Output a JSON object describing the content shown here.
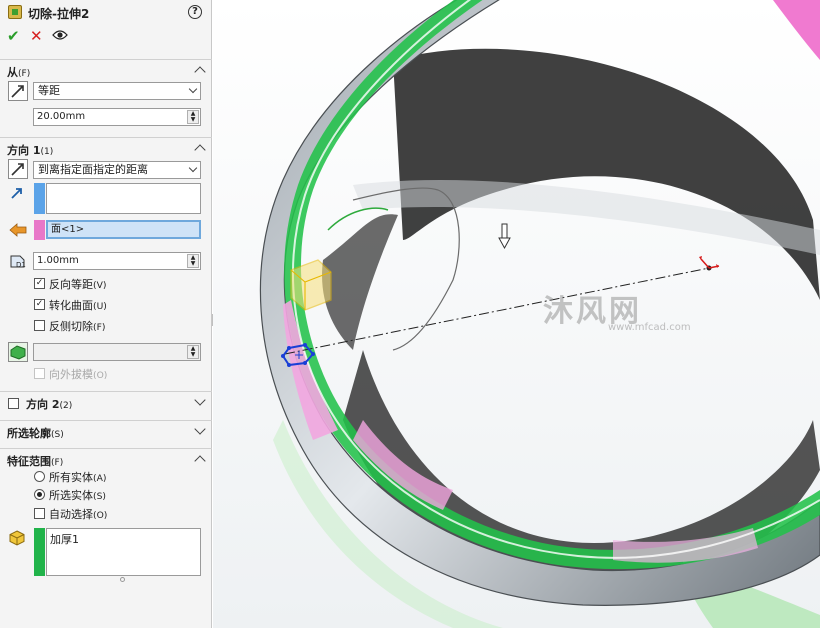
{
  "panel": {
    "title": "切除-拉伸2",
    "help_icon": "help-circle-icon",
    "actions": {
      "ok_icon": "check-icon",
      "cancel_icon": "close-icon",
      "preview_icon": "eye-icon"
    }
  },
  "from": {
    "header": "从",
    "header_key": "(F)",
    "start_condition": "等距",
    "offset_value": "20.00mm"
  },
  "direction1": {
    "header": "方向 1",
    "header_key": "(1)",
    "end_condition": "到离指定面指定的距离",
    "face_selection": "面<1>",
    "offset_distance": "1.00mm",
    "options": [
      {
        "label": "反向等距",
        "key": "(V)",
        "checked": true
      },
      {
        "label": "转化曲面",
        "key": "(U)",
        "checked": true
      },
      {
        "label": "反侧切除",
        "key": "(F)",
        "checked": false
      }
    ],
    "draft_value": "",
    "draft_outward": {
      "label": "向外拔模",
      "key": "(O)",
      "checked": false,
      "disabled": true
    }
  },
  "direction2": {
    "header": "方向 2",
    "header_key": "(2)",
    "checked": false
  },
  "selected_contours": {
    "header": "所选轮廓",
    "header_key": "(S)"
  },
  "feature_scope": {
    "header": "特征范围",
    "header_key": "(F)",
    "radios": [
      {
        "label": "所有实体",
        "key": "(A)",
        "selected": false
      },
      {
        "label": "所选实体",
        "key": "(S)",
        "selected": true
      }
    ],
    "auto_select": {
      "label": "自动选择",
      "key": "(O)",
      "checked": false
    },
    "bodies": [
      "加厚1"
    ]
  },
  "watermark": {
    "text": "沐风网",
    "sub": "www.mfcad.com"
  },
  "colors": {
    "accent_blue": "#4d8fd6",
    "pink": "#e86fc8",
    "green": "#21b34a",
    "ok": "#2a9d2a",
    "cancel": "#d62020"
  }
}
